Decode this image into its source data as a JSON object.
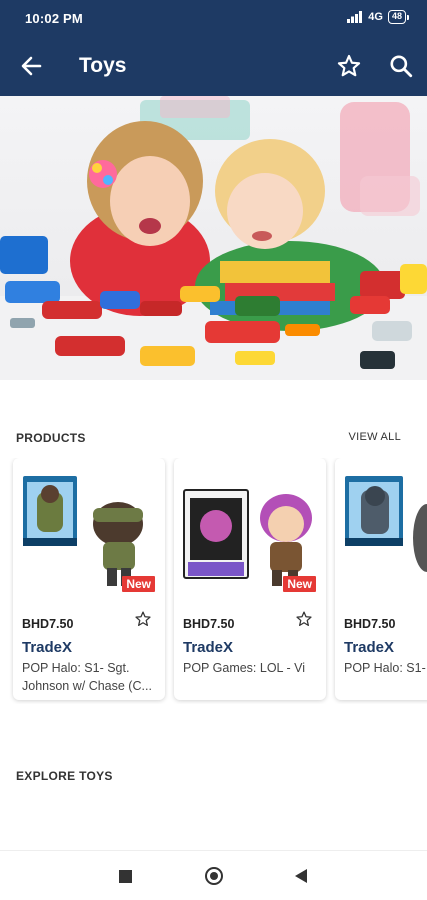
{
  "status": {
    "time": "10:02 PM",
    "network": "4G",
    "battery": "48"
  },
  "appbar": {
    "title": "Toys",
    "back_icon": "arrow-left-icon",
    "favorite_icon": "star-outline-icon",
    "search_icon": "search-icon"
  },
  "banner": {
    "image": "children-playing-with-toy-cars-photo"
  },
  "products_section": {
    "title": "PRODUCTS",
    "view_all": "VIEW ALL"
  },
  "products": [
    {
      "image": "funko-pop-halo-sgt-johnson-figure",
      "badge": "New",
      "price": "BHD7.50",
      "seller": "TradeX",
      "name": "POP Halo: S1- Sgt. Johnson w/ Chase (C..."
    },
    {
      "image": "funko-pop-games-lol-vi-figure",
      "badge": "New",
      "price": "BHD7.50",
      "seller": "TradeX",
      "name": "POP Games: LOL - Vi"
    },
    {
      "image": "funko-pop-halo-figure",
      "badge": "",
      "price": "BHD7.50",
      "seller": "TradeX",
      "name": "POP Halo: S1-"
    }
  ],
  "explore_section": {
    "title": "EXPLORE TOYS"
  },
  "colors": {
    "header": "#1e3a64",
    "seller": "#1e3a64",
    "badge": "#e53935"
  }
}
